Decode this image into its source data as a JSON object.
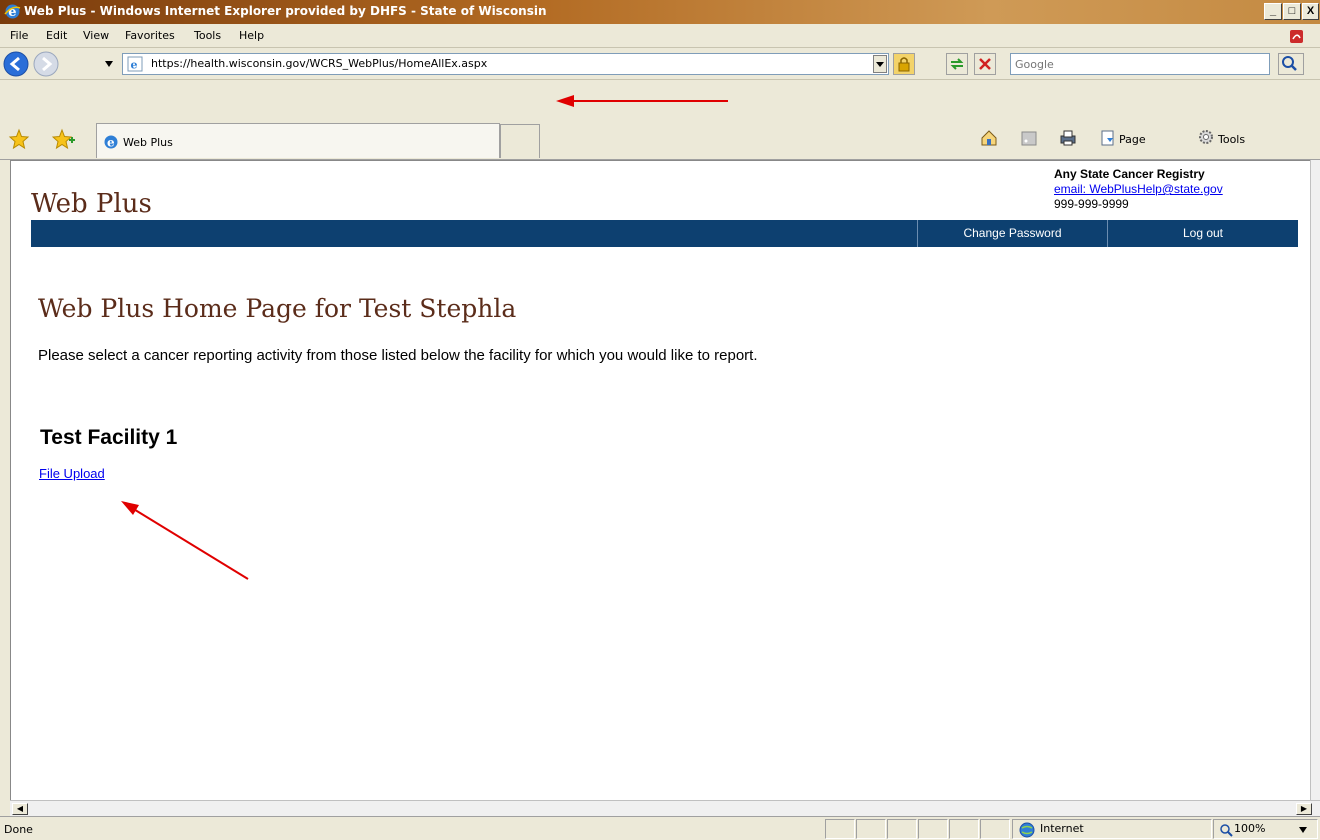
{
  "window": {
    "title": "Web Plus - Windows Internet Explorer provided by DHFS - State of Wisconsin",
    "minimize": "_",
    "maximize": "□",
    "close": "X"
  },
  "menubar": {
    "items": [
      "File",
      "Edit",
      "View",
      "Favorites",
      "Tools",
      "Help"
    ]
  },
  "addressbar": {
    "url": "https://health.wisconsin.gov/WCRS_WebPlus/HomeAllEx.aspx",
    "search_placeholder": "Google"
  },
  "tabs": {
    "active_label": "Web Plus"
  },
  "commands": {
    "page": "Page",
    "tools": "Tools"
  },
  "site": {
    "logo": "Web Plus",
    "registry_name": "Any State Cancer Registry",
    "email": "email: WebPlusHelp@state.gov",
    "phone": "999-999-9999",
    "nav": [
      "Change Password",
      "Log out"
    ]
  },
  "main": {
    "title": "Web Plus Home Page for Test Stephla",
    "intro": "Please select a cancer reporting activity from those listed below the facility for which you would like to report.",
    "facility": "Test Facility 1",
    "link": "File Upload"
  },
  "status": {
    "text": "Done",
    "zone": "Internet",
    "zoom": "100%"
  },
  "colors": {
    "title_brown": "#5b2c1a",
    "nav_blue": "#0d4070",
    "link_blue": "#0000ee",
    "annotation_red": "#e00000"
  }
}
